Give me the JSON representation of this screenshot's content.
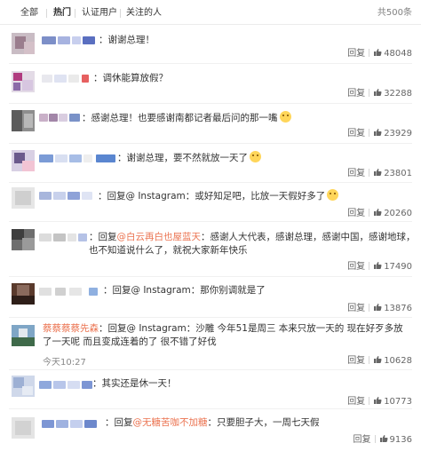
{
  "tabs": {
    "all": "全部",
    "hot": "热门",
    "verified": "认证用户",
    "following": "关注的人",
    "total": "共500条"
  },
  "actions": {
    "reply": "回复"
  },
  "comments": [
    {
      "text": "：谢谢总理！",
      "likes": "48048"
    },
    {
      "text": "：调休能算放假？",
      "likes": "32288"
    },
    {
      "text": "：感谢总理！也要感谢南都记者最后问的那一嘴",
      "likes": "23929"
    },
    {
      "text": "：谢谢总理，要不然就放一天了",
      "likes": "23801"
    },
    {
      "prefix": "：回复",
      "mention": "@ Instagram",
      "text": "：或好知足吧，比放一天假好多了",
      "likes": "20260"
    },
    {
      "prefix": "：回复",
      "mention": "@白云再白也屋蓝天",
      "text": "：感谢人大代表，感谢总理，感谢中国，感谢地球，也不知道说什么了，就祝大家新年快乐",
      "likes": "17490"
    },
    {
      "prefix": "：回复",
      "mention": "@ Instagram",
      "text": "：那你别调就是了",
      "likes": "13876"
    },
    {
      "username": "蔡蔡蔡蔡先森",
      "prefix": "：回复",
      "mention": "@ Instagram",
      "text": "：沙雕 今年51是周三 本来只放一天的 现在好歹多放了一天呢 而且变成连着的了 很不错了好伐",
      "time": "今天10:27",
      "likes": "10628"
    },
    {
      "text": "：其实还是休一天！",
      "likes": "10773"
    },
    {
      "prefix": "：回复",
      "mention": "@无糖苦咖不加糖",
      "text": "：只要胆子大，一周七天假",
      "likes": "9136"
    }
  ]
}
